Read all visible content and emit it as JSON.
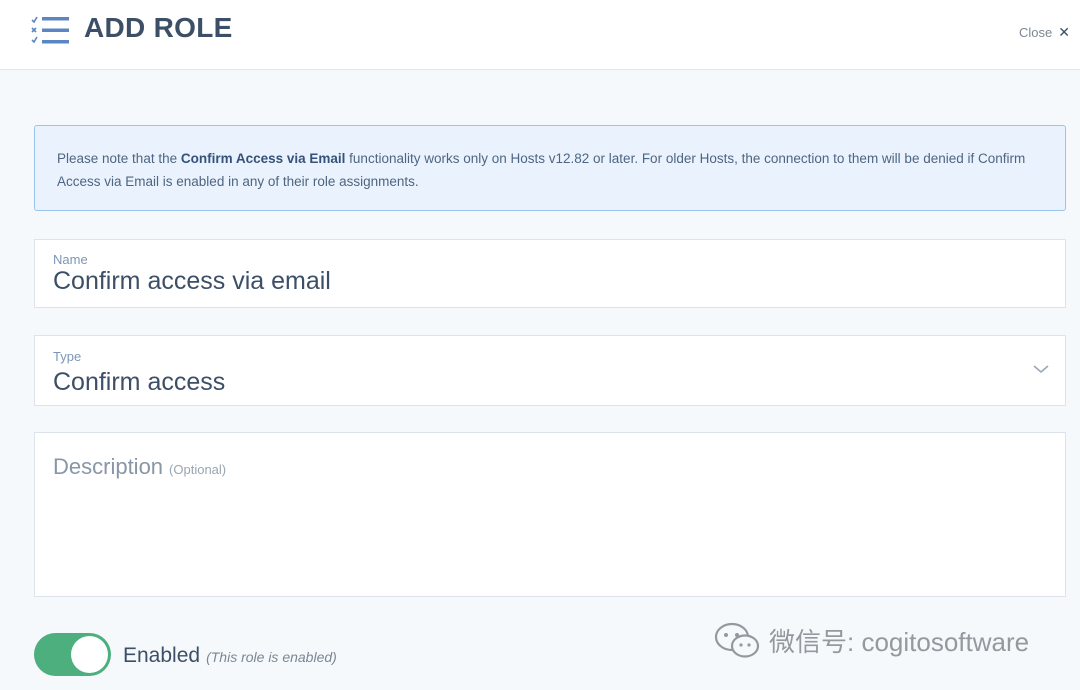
{
  "header": {
    "title": "ADD ROLE",
    "close_label": "Close",
    "close_glyph": "✕"
  },
  "notice": {
    "text_before": "Please note that the ",
    "highlight": "Confirm Access via Email",
    "text_after": " functionality works only on Hosts v12.82 or later. For older Hosts, the connection to them will be denied if Confirm Access via Email is enabled in any of their role assignments."
  },
  "form": {
    "name": {
      "label": "Name",
      "value": "Confirm access via email"
    },
    "type": {
      "label": "Type",
      "value": "Confirm access"
    },
    "description": {
      "placeholder": "Description",
      "optional": "(Optional)"
    },
    "enabled": {
      "label": "Enabled",
      "note": "(This role is enabled)",
      "state": "on"
    }
  },
  "watermark": {
    "text": "微信号: cogitosoftware"
  },
  "colors": {
    "accent": "#4caf7d",
    "notice_bg": "#eaf3fd",
    "notice_border": "#9cc3ec",
    "title": "#3d4f66"
  }
}
